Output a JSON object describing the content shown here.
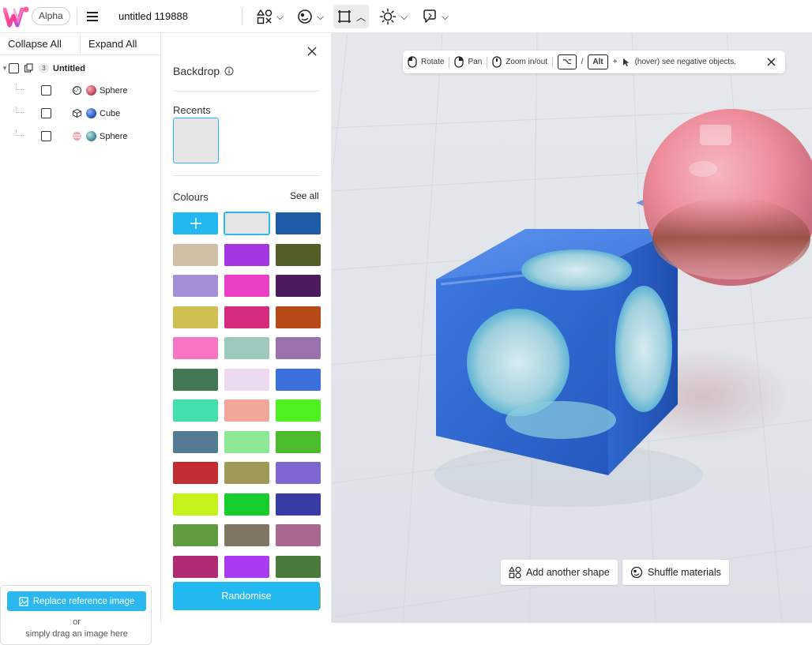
{
  "topbar": {
    "logo": "W",
    "badge": "Alpha",
    "doc_title": "untitled 119888",
    "tools": [
      {
        "icon": "shapes-icon"
      },
      {
        "icon": "material-icon"
      },
      {
        "icon": "frame-icon",
        "active": true
      },
      {
        "icon": "light-icon"
      },
      {
        "icon": "lasso-icon"
      }
    ]
  },
  "tree": {
    "collapse_all": "Collapse All",
    "expand_all": "Expand All",
    "root": {
      "label": "Untitled",
      "count": "3"
    },
    "children": [
      {
        "label": "Sphere",
        "type_icon": "sphere-subtract-icon",
        "color": "#d55a6a"
      },
      {
        "label": "Cube",
        "type_icon": "cube-icon",
        "color": "#2f5fbf"
      },
      {
        "label": "Sphere",
        "type_icon": "sphere-stripes-icon",
        "color": "#4fa0a8"
      }
    ]
  },
  "reference": {
    "button": "Replace reference image",
    "or": "or",
    "hint": "simply drag an image here"
  },
  "backdrop": {
    "title": "Backdrop",
    "recents_label": "Recents",
    "recent_color": "#e6e6e6",
    "colours_label": "Colours",
    "see_all": "See all",
    "swatches": [
      "add",
      "#e4e4e4",
      "#1e5ba6",
      "#cfc0a6",
      "#a335e3",
      "#535e27",
      "#a58fd6",
      "#ea3fc6",
      "#4c1b5e",
      "#cfc14f",
      "#d62c7d",
      "#b84a18",
      "#f776c4",
      "#9cc9bc",
      "#9a71ad",
      "#427753",
      "#ecdaf1",
      "#3b71dc",
      "#42e0ad",
      "#f0a698",
      "#4ef01f",
      "#557a93",
      "#8be895",
      "#4bbc2c",
      "#c12d31",
      "#a09a57",
      "#8066d0",
      "#c6f21c",
      "#15ce2b",
      "#393ba5",
      "#5f9d40",
      "#7f7764",
      "#a7698f",
      "#b02b72",
      "#a93bf2",
      "#4a7b3a",
      "#b85459",
      "#6b5b2a",
      "#c2a030"
    ],
    "randomise": "Randomise"
  },
  "viewport": {
    "hint": {
      "rotate": "Rotate",
      "pan": "Pan",
      "zoom": "Zoom in/out",
      "key1": "⌥",
      "slash": "/",
      "key2": "Alt",
      "plus": "+",
      "negative": "(hover) see negative objects."
    },
    "add_shape": "Add another shape",
    "shuffle": "Shuffle materials"
  }
}
